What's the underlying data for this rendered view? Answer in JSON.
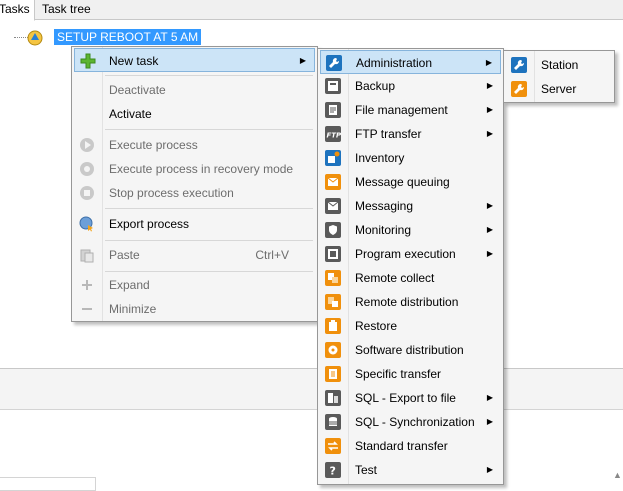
{
  "tabs": [
    "Tasks",
    "Task tree"
  ],
  "tree": {
    "node_label": "SETUP REBOOT AT 5 AM"
  },
  "context_menu": {
    "new_task": "New task",
    "deactivate": "Deactivate",
    "activate": "Activate",
    "execute_process": "Execute process",
    "execute_recovery": "Execute process in recovery mode",
    "stop_process": "Stop process execution",
    "export_process": "Export process",
    "paste": "Paste",
    "paste_shortcut": "Ctrl+V",
    "expand": "Expand",
    "minimize": "Minimize"
  },
  "task_types": [
    {
      "label": "Administration",
      "icon": "wrench-icon",
      "submenu": true
    },
    {
      "label": "Backup",
      "icon": "backup-icon",
      "submenu": true
    },
    {
      "label": "File management",
      "icon": "file-icon",
      "submenu": true
    },
    {
      "label": "FTP transfer",
      "icon": "ftp-icon",
      "submenu": true
    },
    {
      "label": "Inventory",
      "icon": "inventory-icon",
      "submenu": false
    },
    {
      "label": "Message queuing",
      "icon": "mail-queue-icon",
      "submenu": false
    },
    {
      "label": "Messaging",
      "icon": "envelope-icon",
      "submenu": true
    },
    {
      "label": "Monitoring",
      "icon": "shield-icon",
      "submenu": true
    },
    {
      "label": "Program execution",
      "icon": "program-icon",
      "submenu": true
    },
    {
      "label": "Remote collect",
      "icon": "remote-collect-icon",
      "submenu": false
    },
    {
      "label": "Remote distribution",
      "icon": "remote-distribution-icon",
      "submenu": false
    },
    {
      "label": "Restore",
      "icon": "restore-icon",
      "submenu": false
    },
    {
      "label": "Software distribution",
      "icon": "software-icon",
      "submenu": false
    },
    {
      "label": "Specific transfer",
      "icon": "specific-transfer-icon",
      "submenu": false
    },
    {
      "label": "SQL - Export to file",
      "icon": "sql-export-icon",
      "submenu": true
    },
    {
      "label": "SQL - Synchronization",
      "icon": "database-icon",
      "submenu": true
    },
    {
      "label": "Standard transfer",
      "icon": "transfer-icon",
      "submenu": false
    },
    {
      "label": "Test",
      "icon": "question-icon",
      "submenu": true
    }
  ],
  "administration_submenu": [
    {
      "label": "Station",
      "icon": "wrench-blue-icon"
    },
    {
      "label": "Server",
      "icon": "wrench-orange-icon"
    }
  ],
  "colors": {
    "highlight": "#cce4f7",
    "selection": "#3399ff",
    "icon_blue": "#1e73be",
    "icon_orange": "#f0900c",
    "icon_gray": "#5a5a5a"
  }
}
